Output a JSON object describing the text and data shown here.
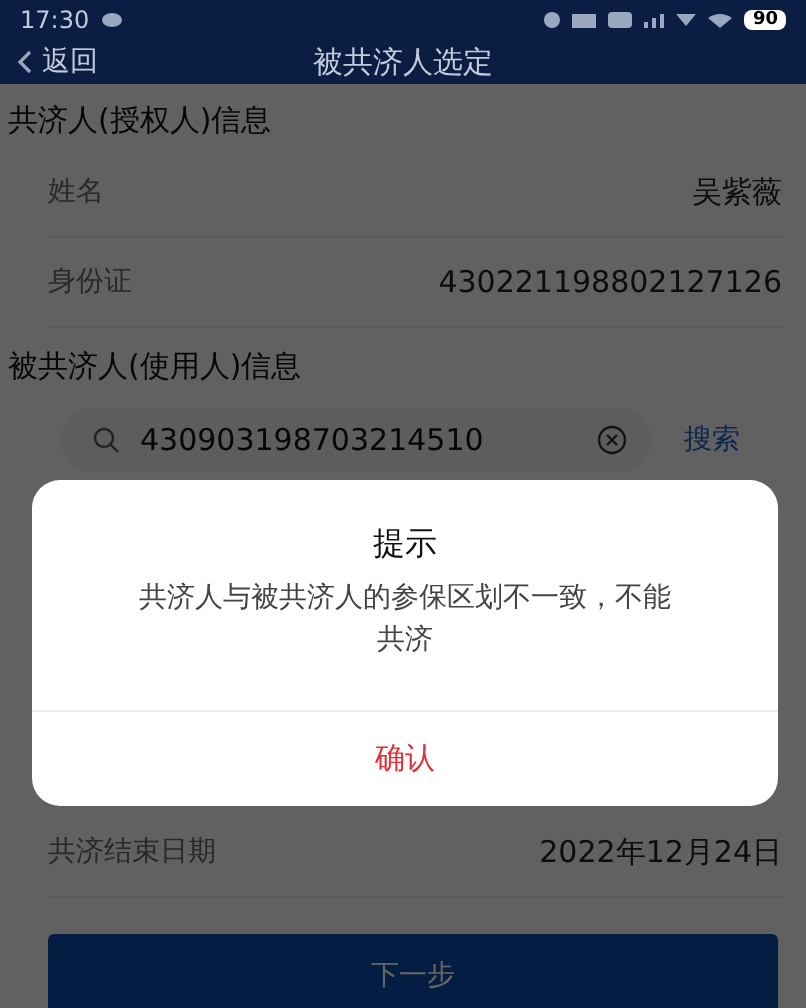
{
  "status_bar": {
    "time": "17:30",
    "battery": "90"
  },
  "nav_bar": {
    "back": "返回",
    "title": "被共济人选定"
  },
  "grantor_section": {
    "heading": "共济人(授权人)信息",
    "rows": [
      {
        "label": "姓名",
        "value": "吴紫薇"
      },
      {
        "label": "身份证",
        "value": "430221198802127126"
      }
    ]
  },
  "user_section": {
    "heading": "被共济人(使用人)信息",
    "search": {
      "value": "430903198703214510",
      "button": "搜索"
    }
  },
  "end_date_row": {
    "label": "共济结束日期",
    "value": "2022年12月24日"
  },
  "next_button": "下一步",
  "dialog": {
    "title": "提示",
    "message": "共济人与被共济人的参保区划不一致，不能共济",
    "confirm": "确认"
  }
}
